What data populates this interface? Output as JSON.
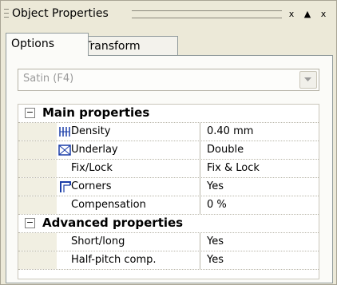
{
  "window": {
    "title": "Object Properties",
    "buttons": [
      "x",
      "▲",
      "x"
    ]
  },
  "tabs": [
    {
      "label": "Options",
      "active": true
    },
    {
      "label": "Transform",
      "active": false
    }
  ],
  "dropdown": {
    "value": "Satin (F4)"
  },
  "grid": {
    "categories": [
      {
        "label": "Main properties",
        "toggle": "−"
      },
      {
        "label": "Advanced properties",
        "toggle": "−"
      }
    ],
    "main": [
      {
        "name": "Density",
        "value": "0.40 mm",
        "icon": "density-icon"
      },
      {
        "name": "Underlay",
        "value": "Double",
        "icon": "underlay-icon"
      },
      {
        "name": "Fix/Lock",
        "value": "Fix & Lock",
        "icon": ""
      },
      {
        "name": "Corners",
        "value": "Yes",
        "icon": "corners-icon"
      },
      {
        "name": "Compensation",
        "value": "0 %",
        "icon": ""
      }
    ],
    "advanced": [
      {
        "name": "Short/long",
        "value": "Yes"
      },
      {
        "name": "Half-pitch comp.",
        "value": "Yes"
      }
    ]
  },
  "colors": {
    "background": "#ece9d8",
    "panel": "#fbfbf8",
    "icon_blue": "#1b3ea8"
  }
}
